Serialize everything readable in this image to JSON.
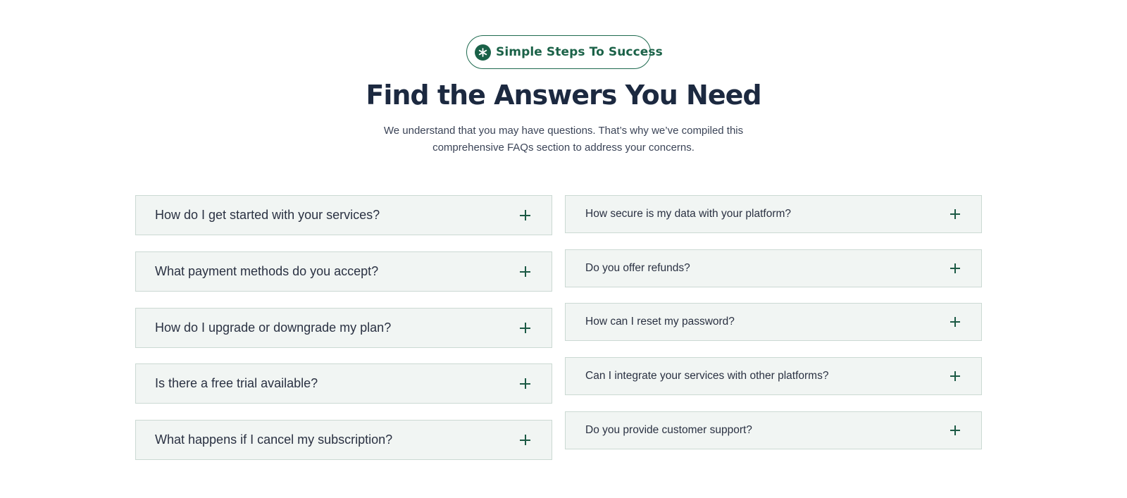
{
  "badge": {
    "icon": "asterisk-icon",
    "label": "Simple Steps To Success"
  },
  "heading": {
    "title": "Find the Answers You Need",
    "subtitle": "We understand that you may have questions. That’s why we’ve compiled this comprehensive FAQs section to address your concerns."
  },
  "faq": {
    "left": [
      {
        "question": "How do I get started with your services?",
        "icon": "plus-icon"
      },
      {
        "question": "What payment methods do you accept?",
        "icon": "plus-icon"
      },
      {
        "question": "How do I upgrade or downgrade my plan?",
        "icon": "plus-icon"
      },
      {
        "question": "Is there a free trial available?",
        "icon": "plus-icon"
      },
      {
        "question": "What happens if I cancel my subscription?",
        "icon": "plus-icon"
      }
    ],
    "right": [
      {
        "question": "How secure is my data with your platform?",
        "icon": "plus-icon"
      },
      {
        "question": "Do you offer refunds?",
        "icon": "plus-icon"
      },
      {
        "question": "How can I reset my password?",
        "icon": "plus-icon"
      },
      {
        "question": "Can I integrate your services with other platforms?",
        "icon": "plus-icon"
      },
      {
        "question": "Do you provide customer support?",
        "icon": "plus-icon"
      }
    ]
  },
  "colors": {
    "accent": "#1b6248",
    "heading": "#1c2940",
    "item_background": "#f1f5f3",
    "item_border": "#cbd9d3"
  }
}
